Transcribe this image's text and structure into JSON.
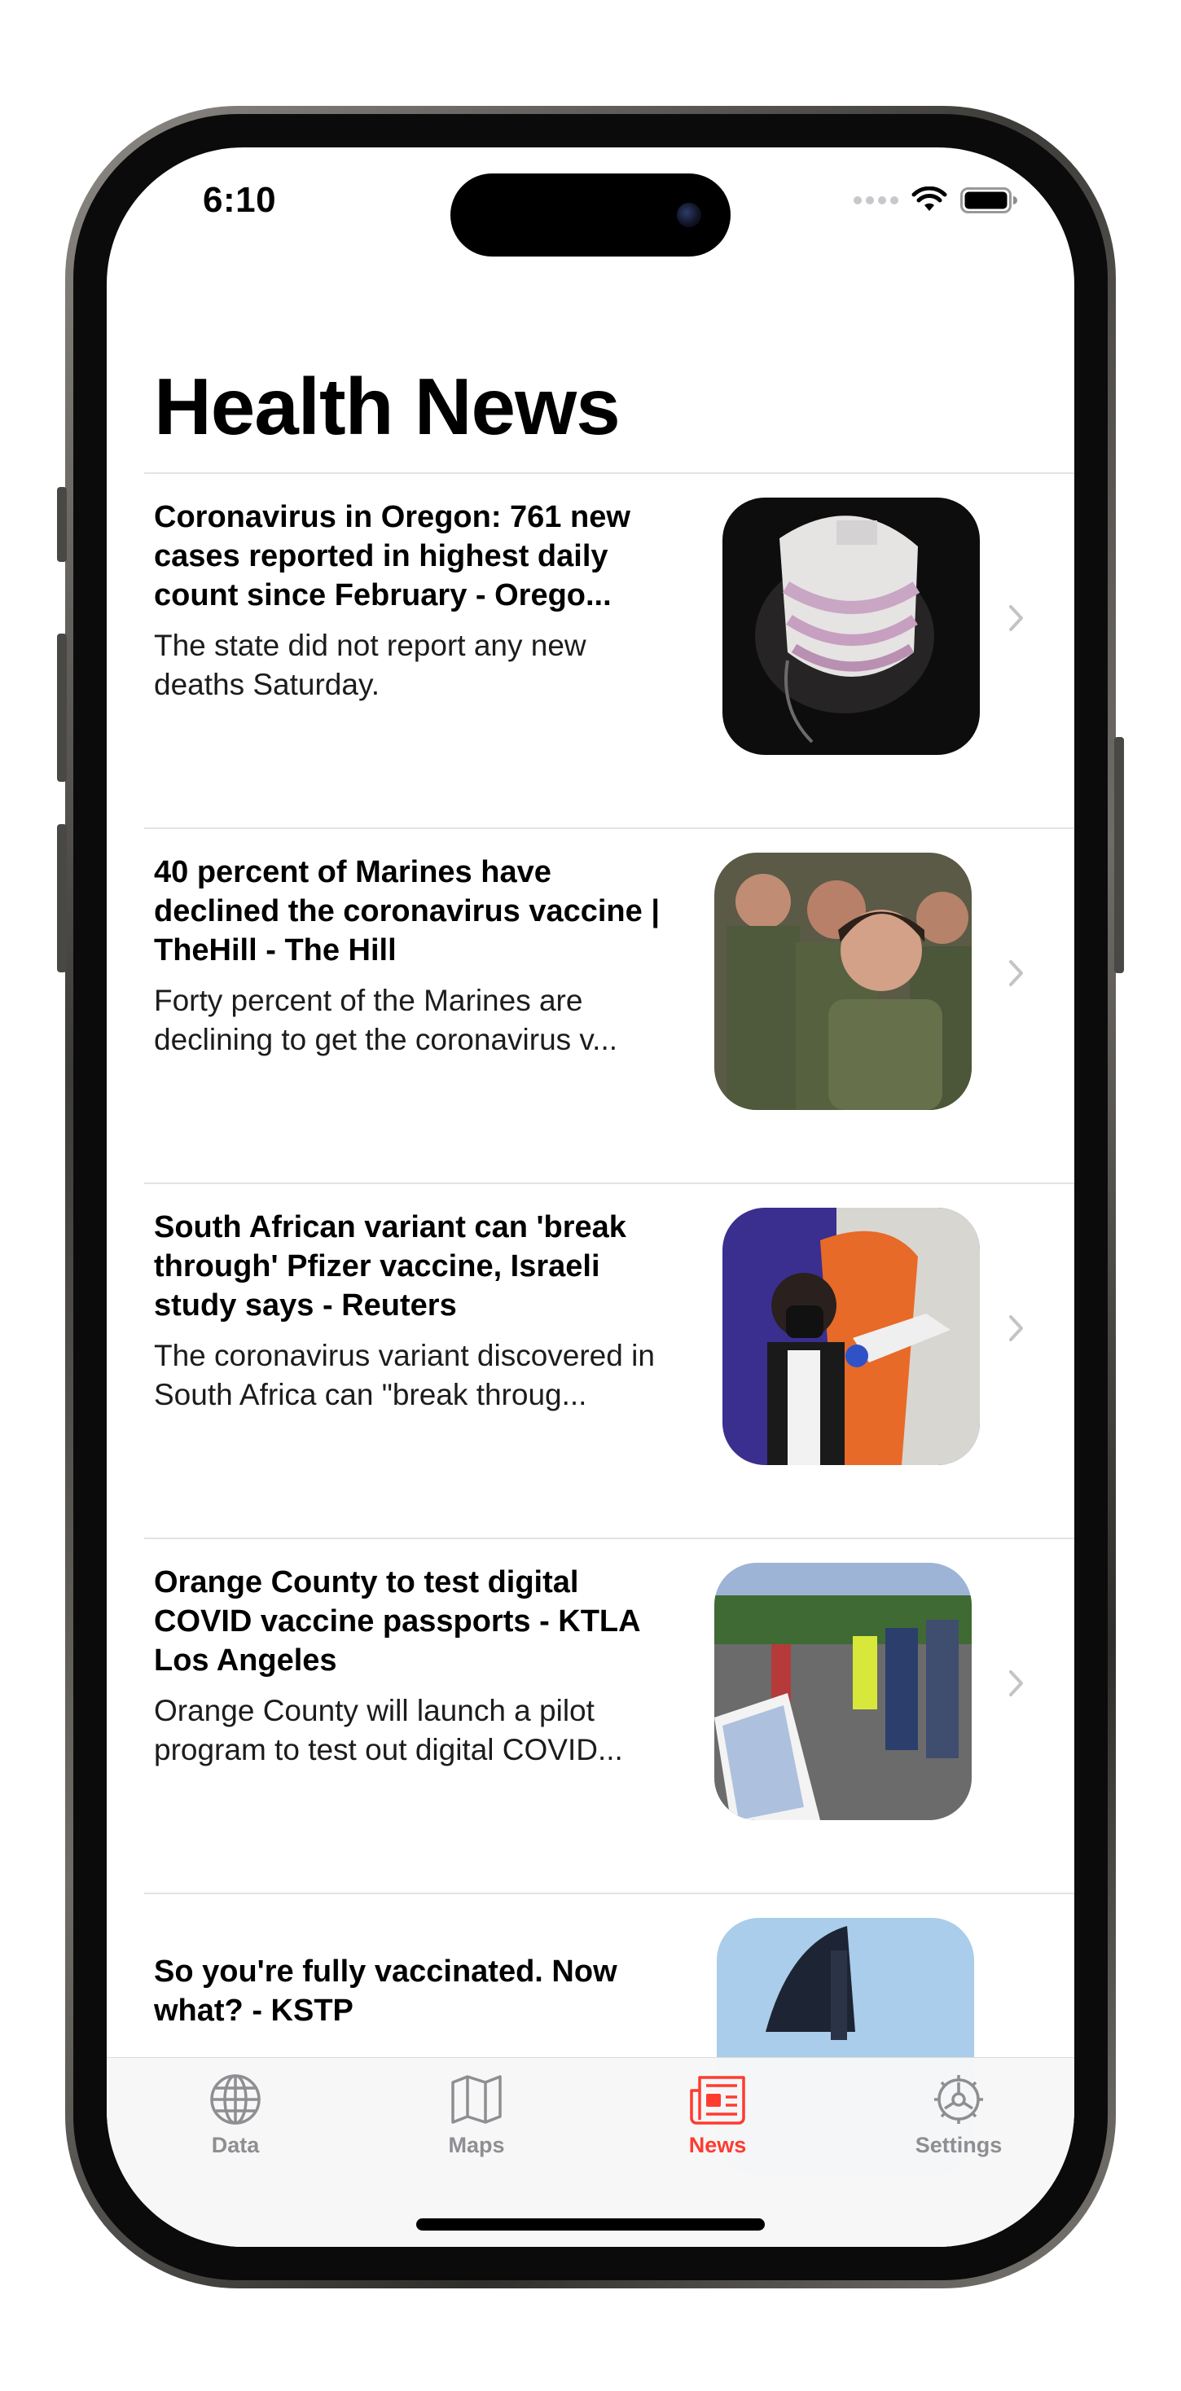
{
  "status_bar": {
    "time": "6:10"
  },
  "header": {
    "title": "Health News"
  },
  "news": [
    {
      "headline": "Coronavirus in Oregon: 761 new cases reported in highest daily count since February - Orego...",
      "summary": "The state did not report any new deaths Saturday.",
      "image": "face-mask-photo"
    },
    {
      "headline": "40 percent of Marines have declined the coronavirus vaccine | TheHill - The Hill",
      "summary": "Forty percent of the Marines are declining to get the coronavirus v...",
      "image": "marines-photo"
    },
    {
      "headline": "South African variant can 'break through' Pfizer vaccine, Israeli study says - Reuters",
      "summary": "The coronavirus variant discovered in South Africa can \"break throug...",
      "image": "vaccination-photo"
    },
    {
      "headline": "Orange County to test digital COVID vaccine passports - KTLA Los Angeles",
      "summary": "Orange County will launch a pilot program to test out digital COVID...",
      "image": "vaccine-site-photo"
    },
    {
      "headline": "So you're fully vaccinated. Now what? - KSTP",
      "summary": "",
      "image": "syringe-photo"
    }
  ],
  "tab_bar": {
    "tabs": [
      {
        "label": "Data",
        "icon": "globe-icon",
        "active": false
      },
      {
        "label": "Maps",
        "icon": "map-icon",
        "active": false
      },
      {
        "label": "News",
        "icon": "newspaper-icon",
        "active": true
      },
      {
        "label": "Settings",
        "icon": "gear-icon",
        "active": false
      }
    ]
  },
  "colors": {
    "accent": "#ff3b30",
    "inactive_tab": "#8e8e93",
    "separator": "#e3e3e6"
  }
}
